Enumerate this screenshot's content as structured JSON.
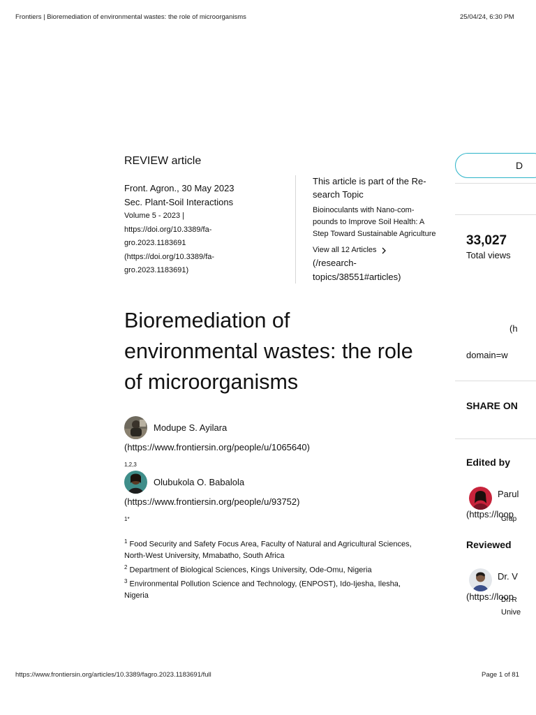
{
  "header": {
    "tab_title": "Frontiers | Bioremediation of environmental wastes: the role of microorganisms",
    "timestamp": "25/04/24, 6:30 PM"
  },
  "footer": {
    "url": "https://www.frontiersin.org/articles/10.3389/fagro.2023.1183691/full",
    "page": "Page 1 of 81"
  },
  "article": {
    "type_label": "REVIEW article",
    "journal_date": "Front. Agron., 30 May 2023",
    "section": "Sec. Plant-Soil Interactions",
    "volume": "Volume 5 - 2023 |",
    "doi_1": "https://doi.org/10.3389/fa-",
    "doi_2": "gro.2023.1183691",
    "doi_3": "(https://doi.org/10.3389/fa-",
    "doi_4": "gro.2023.1183691)",
    "title_line1": "Bioremediation of",
    "title_line2": "environmental wastes: the role",
    "title_line3": "of microorganisms"
  },
  "research_topic": {
    "intro_1": "This article is part of the Re-",
    "intro_2": "search Topic",
    "title_1": "Bioinoculants with Nano-com-",
    "title_2": "pounds to Improve Soil Health: A",
    "title_3": "Step Toward Sustainable Agriculture",
    "view_all": "View all 12 Articles",
    "link_1": "(/research-",
    "link_2": "topics/38551#articles)"
  },
  "authors": [
    {
      "name": "Modupe S. Ayilara",
      "url": "(https://www.frontiersin.org/people/u/1065640)",
      "affiliation_marks": "1,2,3"
    },
    {
      "name": "Olubukola O. Babalola",
      "url": "(https://www.frontiersin.org/people/u/93752)",
      "affiliation_marks": "1*"
    }
  ],
  "affiliations": [
    {
      "num": "1",
      "text": "Food Security and Safety Focus Area, Faculty of Natural and Agricultural Sciences,"
    },
    {
      "num": "",
      "text": "North-West University, Mmabatho, South Africa"
    },
    {
      "num": "2",
      "text": "Department of Biological Sciences, Kings University, Ode-Omu, Nigeria"
    },
    {
      "num": "3",
      "text": "Environmental Pollution Science and Technology, (ENPOST), Ido-Ijesha, Ilesha,"
    },
    {
      "num": "",
      "text": "Nigeria"
    }
  ],
  "sidebar": {
    "button_label": "D",
    "total_views_number": "33,027",
    "total_views_label": "Total views",
    "link_fragment_1": "(h",
    "link_fragment_2": "domain=w",
    "share_heading": "SHARE ON",
    "edited_heading": "Edited by",
    "editor_name": "Parul",
    "editor_url": "(https://loop",
    "editor_note": "Grap",
    "reviewed_heading": "Reviewed",
    "reviewer_name": "Dr. V",
    "reviewer_url": "(https://loop",
    "reviewer_note_1": "Dr. R",
    "reviewer_note_2": "Unive"
  },
  "colors": {
    "accent_teal": "#2bb3c8",
    "text": "#111111",
    "divider": "#d6d6d6"
  }
}
